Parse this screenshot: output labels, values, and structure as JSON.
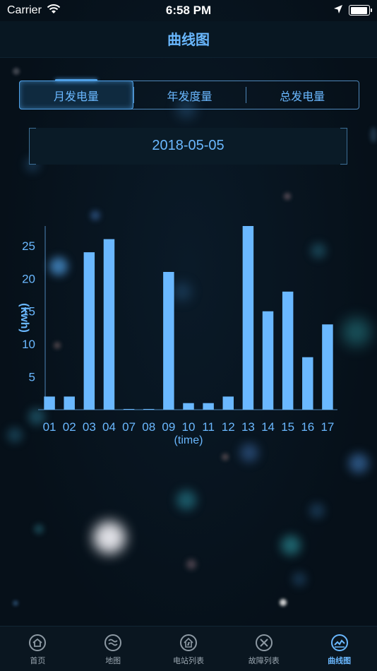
{
  "status_bar": {
    "carrier": "Carrier",
    "time": "6:58 PM"
  },
  "nav": {
    "title": "曲线图"
  },
  "tabs": [
    {
      "label": "月发电量",
      "active": true
    },
    {
      "label": "年发度量",
      "active": false
    },
    {
      "label": "总发电量",
      "active": false
    }
  ],
  "date": "2018-05-05",
  "chart_data": {
    "type": "bar",
    "categories": [
      "01",
      "02",
      "03",
      "04",
      "07",
      "08",
      "09",
      "10",
      "11",
      "12",
      "13",
      "14",
      "15",
      "16",
      "17"
    ],
    "values": [
      2,
      2,
      24,
      26,
      0,
      0,
      21,
      1,
      1,
      2,
      28,
      15,
      18,
      8,
      13
    ],
    "ylabel": "(kwh)",
    "xlabel": "(time)",
    "yticks": [
      5,
      10,
      15,
      20,
      25
    ],
    "ylim": [
      0,
      28
    ],
    "bar_color": "#6ab8ff",
    "grid": false,
    "legend": "none"
  },
  "tab_bar": {
    "items": [
      {
        "label": "首页",
        "icon": "home-icon",
        "active": false
      },
      {
        "label": "地图",
        "icon": "map-icon",
        "active": false
      },
      {
        "label": "电站列表",
        "icon": "station-list-icon",
        "active": false
      },
      {
        "label": "故障列表",
        "icon": "fault-list-icon",
        "active": false
      },
      {
        "label": "曲线图",
        "icon": "curve-chart-icon",
        "active": true
      }
    ]
  },
  "colors": {
    "accent": "#6ab8ff",
    "background": "#061019",
    "inactive_tab": "#9aa6b0"
  }
}
